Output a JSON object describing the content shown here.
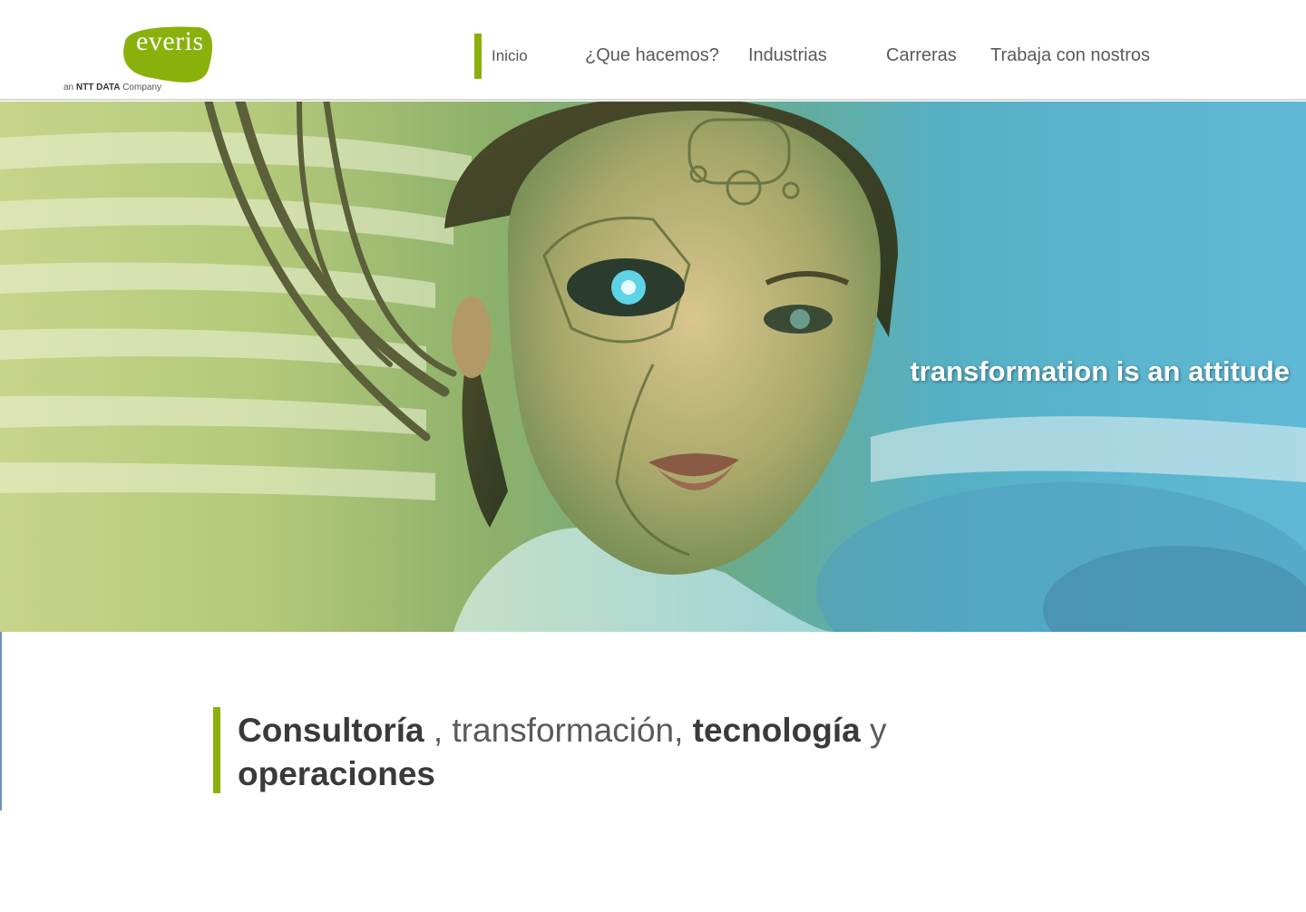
{
  "brand": {
    "logo_text": "everis",
    "tagline_prefix": "an",
    "tagline_bold": "NTT DATA",
    "tagline_suffix": "Company",
    "accent_color": "#8ab10b"
  },
  "nav": {
    "items": [
      {
        "label": "Inicio",
        "active": true
      },
      {
        "label": "¿Que hacemos?"
      },
      {
        "label": "Industrias"
      },
      {
        "label": "Carreras"
      },
      {
        "label": "Trabaja con nostros"
      }
    ]
  },
  "hero": {
    "tagline": "transformation is an attitude"
  },
  "headline": {
    "part1": "Consultoría",
    "part2": " , transformación, ",
    "part3": "tecnología",
    "part4": " y",
    "part5": "operaciones"
  }
}
